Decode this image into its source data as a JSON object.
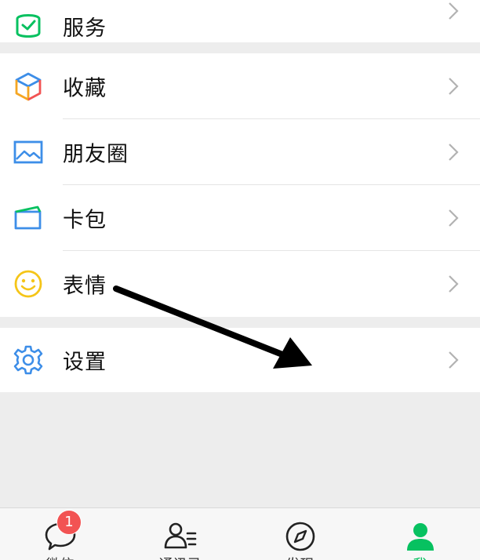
{
  "colors": {
    "accent": "#07c160",
    "badge": "#f25353",
    "background": "#ededed"
  },
  "menu": {
    "service": {
      "label": "服务",
      "icon": "service-wallet-icon"
    },
    "favorites": {
      "label": "收藏",
      "icon": "favorites-cube-icon"
    },
    "moments": {
      "label": "朋友圈",
      "icon": "moments-picture-icon"
    },
    "cards": {
      "label": "卡包",
      "icon": "card-wallet-icon"
    },
    "stickers": {
      "label": "表情",
      "icon": "smiley-icon"
    },
    "settings": {
      "label": "设置",
      "icon": "gear-icon"
    }
  },
  "tabbar": {
    "chats": {
      "label": "微信",
      "badge": "1",
      "icon": "chat-bubble-icon"
    },
    "contacts": {
      "label": "通讯录",
      "icon": "contacts-icon"
    },
    "discover": {
      "label": "发现",
      "icon": "compass-icon"
    },
    "me": {
      "label": "我",
      "icon": "person-icon"
    }
  }
}
